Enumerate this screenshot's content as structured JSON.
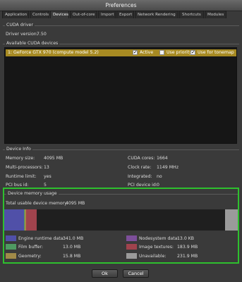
{
  "window": {
    "title": "Preferences"
  },
  "tabs": [
    {
      "label": "Application"
    },
    {
      "label": "Controls"
    },
    {
      "label": "Devices"
    },
    {
      "label": "Out-of-core"
    },
    {
      "label": "Import"
    },
    {
      "label": "Export"
    },
    {
      "label": "Network Rendering"
    },
    {
      "label": "Shortcuts"
    },
    {
      "label": "Modules"
    }
  ],
  "cuda_driver": {
    "title": "CUDA driver",
    "label": "Driver version:",
    "value": "7.50"
  },
  "available_devices": {
    "title": "Available CUDA devices",
    "devices": [
      {
        "name": "1: GeForce GTX 970 (compute model 5.2)",
        "active": {
          "label": "Active",
          "checked": true
        },
        "priority": {
          "label": "Use priority",
          "checked": false
        },
        "tonemap": {
          "label": "Use for tonemap",
          "checked": true
        }
      }
    ]
  },
  "device_info": {
    "title": "Device Info",
    "memory_size": {
      "label": "Memory size:",
      "value": "4095 MB"
    },
    "multiprocessors": {
      "label": "Multi-processors:",
      "value": "13"
    },
    "runtime_limit": {
      "label": "Runtime limit:",
      "value": "yes"
    },
    "pci_bus": {
      "label": "PCI bus id:",
      "value": "5"
    },
    "cuda_cores": {
      "label": "CUDA cores:",
      "value": "1664"
    },
    "clock_rate": {
      "label": "Clock rate:",
      "value": "1149 MHz"
    },
    "integrated": {
      "label": "Integrated:",
      "value": "no"
    },
    "pci_device": {
      "label": "PCI device id:",
      "value": "0"
    }
  },
  "memory_usage": {
    "title": "Device memory usage",
    "total_label": "Total usable device memory:",
    "total_value": "4095 MB",
    "colors": {
      "engine": "#5050a8",
      "film": "#4f9a62",
      "geometry": "#a08a48",
      "nodesystem": "#7d4f9a",
      "textures": "#a0434d",
      "unavailable": "#9a9a9a"
    },
    "legend": {
      "engine": {
        "label": "Engine runtime data:",
        "value": "341.0 MB"
      },
      "film": {
        "label": "Film buffer:",
        "value": "13.0 MB"
      },
      "geometry": {
        "label": "Geometry:",
        "value": "15.8 MB"
      },
      "nodesystem": {
        "label": "Nodesystem data:",
        "value": "13.0 KB"
      },
      "textures": {
        "label": "Image textures:",
        "value": "183.9 MB"
      },
      "unavailable": {
        "label": "Unavailable:",
        "value": "231.9 MB"
      }
    }
  },
  "buttons": {
    "ok": "Ok",
    "cancel": "Cancel"
  }
}
